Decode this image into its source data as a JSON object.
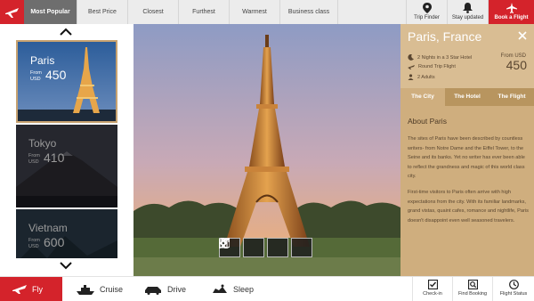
{
  "top_nav": {
    "tabs": [
      {
        "label": "Most Popular",
        "active": true
      },
      {
        "label": "Best Price",
        "active": false
      },
      {
        "label": "Closest",
        "active": false
      },
      {
        "label": "Furthest",
        "active": false
      },
      {
        "label": "Warmest",
        "active": false
      },
      {
        "label": "Business class",
        "active": false
      }
    ],
    "tools": [
      {
        "label": "Trip Finder",
        "icon": "map-pin-icon"
      },
      {
        "label": "Stay updated",
        "icon": "bell-icon"
      },
      {
        "label": "Book a Flight",
        "icon": "plane-icon"
      }
    ]
  },
  "destinations": [
    {
      "city": "Paris",
      "from_label": "From",
      "currency": "USD",
      "price": "450",
      "selected": true
    },
    {
      "city": "Tokyo",
      "from_label": "From",
      "currency": "USD",
      "price": "410",
      "selected": false
    },
    {
      "city": "Vietnam",
      "from_label": "From",
      "currency": "USD",
      "price": "600",
      "selected": false
    }
  ],
  "info": {
    "title": "Paris, France",
    "details": [
      {
        "icon": "moon-icon",
        "text": "2 Nights in a 3 Star Hotel"
      },
      {
        "icon": "plane-icon",
        "text": "Round Trip Flight"
      },
      {
        "icon": "person-icon",
        "text": "2 Adults"
      }
    ],
    "from_label": "From",
    "currency": "USD",
    "price": "450",
    "tabs": [
      {
        "label": "The City",
        "active": true
      },
      {
        "label": "The Hotel",
        "active": false
      },
      {
        "label": "The Flight",
        "active": false
      }
    ],
    "about_title": "About Paris",
    "paragraphs": [
      "The sites of Paris have been described by countless writers- from Notre Dame and the Eiffel Tower, to the Seine and its banks. Yet no writer has ever been able to reflect the grandness and magic of this world class city.",
      "First-time visitors to Paris often arrive with high expectations from the city. With its familiar landmarks, grand vistas, quaint cafes, romance and nightlife, Paris doesn't disappoint even well seasoned travelers."
    ]
  },
  "bottom_nav": {
    "modes": [
      {
        "label": "Fly",
        "icon": "plane-icon",
        "active": true
      },
      {
        "label": "Cruise",
        "icon": "ship-icon",
        "active": false
      },
      {
        "label": "Drive",
        "icon": "car-icon",
        "active": false
      },
      {
        "label": "Sleep",
        "icon": "bed-icon",
        "active": false
      }
    ],
    "tools": [
      {
        "label": "Check-in",
        "icon": "checkbox-icon"
      },
      {
        "label": "Find Booking",
        "icon": "search-booking-icon"
      },
      {
        "label": "Flight Status",
        "icon": "clock-icon"
      }
    ]
  },
  "colors": {
    "brand_red": "#d4232b",
    "info_panel": "#cfae7e",
    "active_tab": "#6e6e6e"
  }
}
